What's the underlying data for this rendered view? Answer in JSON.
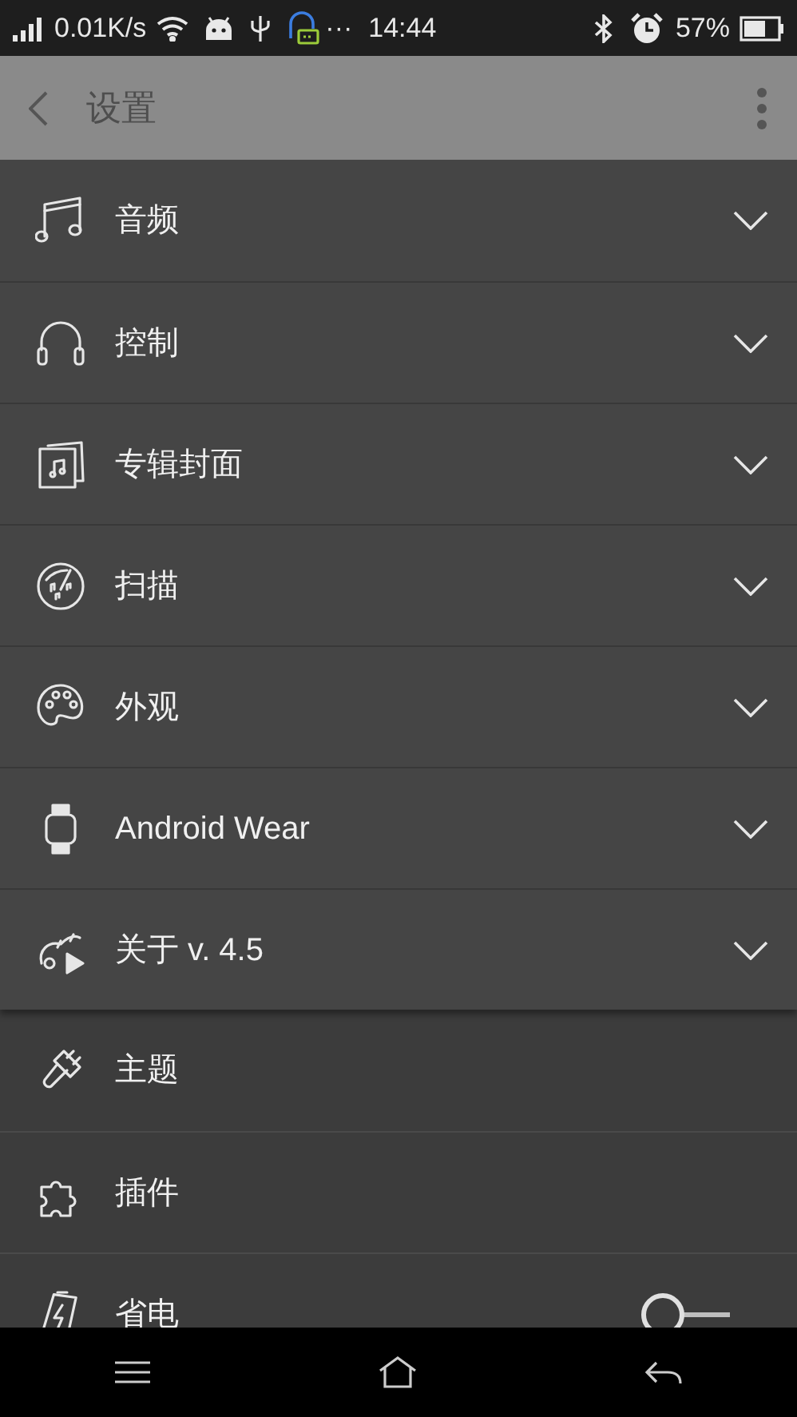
{
  "status_bar": {
    "speed": "0.01K/s",
    "more": "···",
    "time": "14:44",
    "battery": "57%"
  },
  "app_bar": {
    "title": "设置"
  },
  "sections": [
    {
      "label": "音频",
      "expanded": false
    },
    {
      "label": "控制",
      "expanded": false
    },
    {
      "label": "专辑封面",
      "expanded": false
    },
    {
      "label": "扫描",
      "expanded": false
    },
    {
      "label": "外观",
      "expanded": false
    },
    {
      "label": "Android Wear",
      "expanded": false
    },
    {
      "label": "关于 v. 4.5",
      "expanded": false
    }
  ],
  "items": [
    {
      "kind": "link",
      "label": "主题"
    },
    {
      "kind": "link",
      "label": "插件"
    },
    {
      "kind": "toggle",
      "label": "省电",
      "on": false
    }
  ]
}
